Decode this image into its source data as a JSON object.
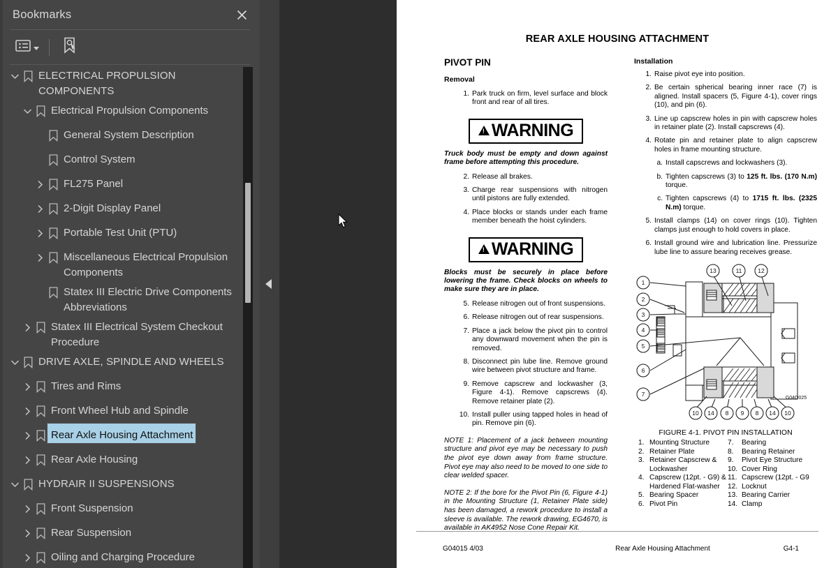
{
  "panel": {
    "title": "Bookmarks",
    "close_icon": "close-icon",
    "toolbar": {
      "options_icon": "list-options-icon",
      "find_icon": "find-bookmark-icon"
    }
  },
  "bookmarks": [
    {
      "label": "ELECTRICAL PROPULSION\nCOMPONENTS",
      "level": 0,
      "state": "expanded",
      "caps": true,
      "selected": false
    },
    {
      "label": "Electrical Propulsion Components",
      "level": 1,
      "state": "expanded",
      "caps": false,
      "selected": false
    },
    {
      "label": "General System Description",
      "level": 2,
      "state": "leaf",
      "caps": false,
      "selected": false
    },
    {
      "label": "Control System",
      "level": 2,
      "state": "leaf",
      "caps": false,
      "selected": false
    },
    {
      "label": "FL275 Panel",
      "level": 2,
      "state": "collapsed",
      "caps": false,
      "selected": false
    },
    {
      "label": "2-Digit Display Panel",
      "level": 2,
      "state": "collapsed",
      "caps": false,
      "selected": false
    },
    {
      "label": "Portable Test Unit (PTU)",
      "level": 2,
      "state": "collapsed",
      "caps": false,
      "selected": false
    },
    {
      "label": "Miscellaneous Electrical Propulsion\nComponents",
      "level": 2,
      "state": "collapsed",
      "caps": false,
      "selected": false
    },
    {
      "label": "Statex III Electric Drive Components\nAbbreviations",
      "level": 2,
      "state": "leaf",
      "caps": false,
      "selected": false
    },
    {
      "label": "Statex III Electrical System Checkout\nProcedure",
      "level": 1,
      "state": "collapsed",
      "caps": false,
      "selected": false
    },
    {
      "label": "DRIVE AXLE, SPINDLE AND WHEELS",
      "level": 0,
      "state": "expanded",
      "caps": true,
      "selected": false
    },
    {
      "label": "Tires and Rims",
      "level": 1,
      "state": "collapsed",
      "caps": false,
      "selected": false
    },
    {
      "label": "Front Wheel Hub and Spindle",
      "level": 1,
      "state": "collapsed",
      "caps": false,
      "selected": false
    },
    {
      "label": "Rear Axle Housing Attachment",
      "level": 1,
      "state": "collapsed",
      "caps": false,
      "selected": true
    },
    {
      "label": "Rear Axle Housing",
      "level": 1,
      "state": "collapsed",
      "caps": false,
      "selected": false
    },
    {
      "label": "HYDRAIR II SUSPENSIONS",
      "level": 0,
      "state": "expanded",
      "caps": true,
      "selected": false
    },
    {
      "label": "Front Suspension",
      "level": 1,
      "state": "collapsed",
      "caps": false,
      "selected": false
    },
    {
      "label": "Rear Suspension",
      "level": 1,
      "state": "collapsed",
      "caps": false,
      "selected": false
    },
    {
      "label": "Oiling and Charging Procedure",
      "level": 1,
      "state": "collapsed",
      "caps": false,
      "selected": false
    }
  ],
  "colors": {
    "panel_bg": "#454545",
    "selection": "#a8d0e6",
    "gutter": "#2d2d2d",
    "page": "#ffffff",
    "scroll_thumb": "#b4b4b4"
  },
  "document": {
    "title": "REAR AXLE HOUSING ATTACHMENT",
    "left": {
      "heading": "PIVOT PIN",
      "sub_heading": "Removal",
      "steps_before_warning1": [
        {
          "num": "1.",
          "text": "Park truck on firm, level surface and block front and rear of all tires."
        }
      ],
      "warning1": {
        "label": "WARNING",
        "body": "Truck body must be empty and down against frame before attempting this procedure."
      },
      "steps_after_warning1": [
        {
          "num": "2.",
          "text": "Release all brakes."
        },
        {
          "num": "3.",
          "text": "Charge rear suspensions with nitrogen until pistons are fully extended."
        },
        {
          "num": "4.",
          "text": "Place blocks or stands under each frame member beneath the hoist cylinders."
        }
      ],
      "warning2": {
        "label": "WARNING",
        "body": "Blocks must be securely in place before lowering the frame. Check blocks on wheels to make sure they are in place."
      },
      "steps_after_warning2": [
        {
          "num": "5.",
          "text": "Release nitrogen out of front suspensions."
        },
        {
          "num": "6.",
          "text": "Release nitrogen out of rear suspensions."
        },
        {
          "num": "7.",
          "text": "Place a jack below the pivot pin to control any downward movement when the pin is removed."
        },
        {
          "num": "8.",
          "text": "Disconnect pin lube line. Remove ground wire between pivot structure and frame."
        },
        {
          "num": "9.",
          "text": "Remove capscrew and lockwasher (3, Figure 4-1). Remove capscrews (4). Remove retainer plate (2)."
        },
        {
          "num": "10.",
          "text": "Install puller using tapped holes in head of pin. Remove pin (6)."
        }
      ],
      "note1": "NOTE 1: Placement of a jack between mounting structure and pivot eye may be necessary to push the pivot eye down away from frame structure. Pivot eye may also need to be moved to one side to clear welded spacer.",
      "note2": "NOTE 2: If the bore for the Pivot Pin (6, Figure 4-1) in the Mounting Structure (1, Retainer Plate side) has been damaged, a rework procedure to install a sleeve is available. The rework drawing, EG4670, is available in AK4952 Nose Cone Repair Kit."
    },
    "right": {
      "heading": "Installation",
      "steps": [
        {
          "num": "1.",
          "text": "Raise pivot eye into position.",
          "sub": false
        },
        {
          "num": "2.",
          "text": "Be certain spherical bearing inner race (7) is aligned. Install spacers (5, Figure 4-1), cover rings (10), and pin (6).",
          "sub": false
        },
        {
          "num": "3.",
          "text": "Line up capscrew holes in pin with capscrew holes in retainer plate (2). Install capscrews (4).",
          "sub": false
        },
        {
          "num": "4.",
          "text": "Rotate pin and retainer plate to align capscrew holes in frame mounting structure.",
          "sub": false
        },
        {
          "num": "a.",
          "text": "Install capscrews and lockwashers (3).",
          "sub": true
        },
        {
          "num": "b.",
          "text": "Tighten capscrews (3) to 125 ft. lbs. (170 N.m) torque.",
          "sub": true,
          "bold_part": "125 ft. lbs. (170 N.m)"
        },
        {
          "num": "c.",
          "text": "Tighten capscrews (4) to 1715 ft. lbs. (2325 N.m) torque.",
          "sub": true,
          "bold_part": "1715 ft. lbs. (2325 N.m)"
        },
        {
          "num": "5.",
          "text": "Install clamps (14) on cover rings (10). Tighten clamps just enough to hold covers in place.",
          "sub": false
        },
        {
          "num": "6.",
          "text": "Install ground wire and lubrication line. Pressurize lube line to assure bearing receives grease.",
          "sub": false
        }
      ],
      "figure_code": "G04O025",
      "figure_caption": "FIGURE 4-1. PIVOT PIN INSTALLATION",
      "legend_left": [
        {
          "n": "1.",
          "t": "Mounting Structure"
        },
        {
          "n": "2.",
          "t": "Retainer Plate"
        },
        {
          "n": "3.",
          "t": "Retainer Capscrew & Lockwasher"
        },
        {
          "n": "4.",
          "t": "Capscrew (12pt. - G9) & Hardened Flat-washer"
        },
        {
          "n": "5.",
          "t": "Bearing Spacer"
        },
        {
          "n": "6.",
          "t": "Pivot Pin"
        }
      ],
      "legend_right": [
        {
          "n": "7.",
          "t": "Bearing"
        },
        {
          "n": "8.",
          "t": "Bearing Retainer"
        },
        {
          "n": "9.",
          "t": "Pivot Eye Structure"
        },
        {
          "n": "10.",
          "t": "Cover Ring"
        },
        {
          "n": "11.",
          "t": "Capscrew (12pt. - G9"
        },
        {
          "n": "12.",
          "t": "Locknut"
        },
        {
          "n": "13.",
          "t": "Bearing Carrier"
        },
        {
          "n": "14.",
          "t": "Clamp"
        }
      ],
      "callouts_left": [
        "1",
        "2",
        "3",
        "4",
        "5",
        "6",
        "7"
      ],
      "callouts_top": [
        "13",
        "11",
        "12"
      ],
      "callouts_bottom": [
        "10",
        "14",
        "8",
        "9",
        "8",
        "14",
        "10"
      ]
    },
    "footer": {
      "left": "G04015  4/03",
      "middle": "Rear Axle Housing Attachment",
      "right": "G4-1"
    }
  }
}
